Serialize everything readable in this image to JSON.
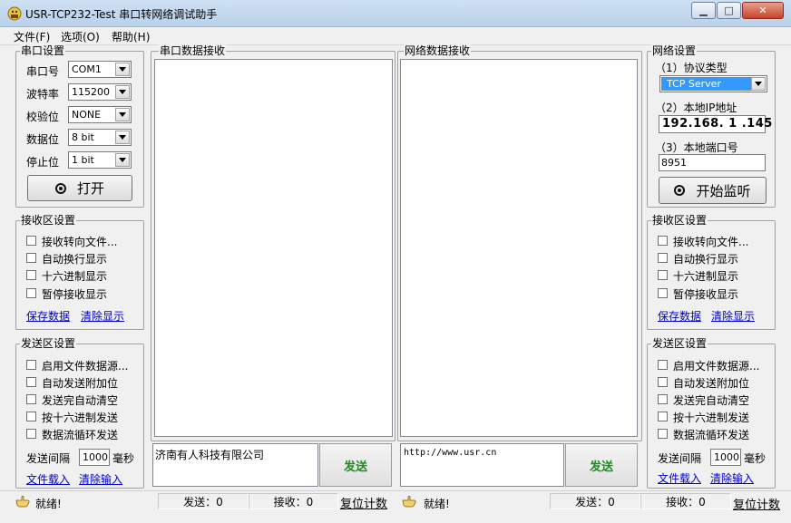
{
  "window": {
    "title": "USR-TCP232-Test 串口转网络调试助手",
    "min_icon": "minimize-icon",
    "max_icon": "maximize-icon",
    "close_icon": "close-icon",
    "min_glyph": "▁",
    "max_glyph": "□",
    "close_glyph": "✕"
  },
  "menu": [
    "文件(F)",
    "选项(O)",
    "帮助(H)"
  ],
  "serial_settings": {
    "title": "串口设置",
    "port_label": "串口号",
    "port_value": "COM1",
    "baud_label": "波特率",
    "baud_value": "115200",
    "parity_label": "校验位",
    "parity_value": "NONE",
    "data_bits_label": "数据位",
    "data_bits_value": "8 bit",
    "stop_bits_label": "停止位",
    "stop_bits_value": "1 bit",
    "open_button": "打开"
  },
  "serial_receive_settings": {
    "title": "接收区设置",
    "options": [
      "接收转向文件...",
      "自动换行显示",
      "十六进制显示",
      "暂停接收显示"
    ],
    "save_link": "保存数据",
    "clear_link": "清除显示"
  },
  "serial_send_settings": {
    "title": "发送区设置",
    "options": [
      "启用文件数据源...",
      "自动发送附加位",
      "发送完自动清空",
      "按十六进制发送",
      "数据流循环发送"
    ],
    "interval_label": "发送间隔",
    "interval_value": "1000",
    "interval_unit": "毫秒",
    "load_link": "文件载入",
    "clear_link": "清除输入"
  },
  "serial_receive_panel": {
    "title": "串口数据接收"
  },
  "network_receive_panel": {
    "title": "网络数据接收"
  },
  "serial_send": {
    "text": "济南有人科技有限公司",
    "button": "发送"
  },
  "network_send": {
    "text": "http://www.usr.cn",
    "button": "发送"
  },
  "network_settings": {
    "title": "网络设置",
    "protocol_label": "（1）协议类型",
    "protocol_value": "TCP Server",
    "ip_label": "（2）本地IP地址",
    "ip_value": "192.168. 1 .145",
    "port_label": "（3）本地端口号",
    "port_value": "8951",
    "listen_button": "开始监听"
  },
  "network_receive_settings": {
    "title": "接收区设置",
    "options": [
      "接收转向文件...",
      "自动换行显示",
      "十六进制显示",
      "暂停接收显示"
    ],
    "save_link": "保存数据",
    "clear_link": "清除显示"
  },
  "network_send_settings": {
    "title": "发送区设置",
    "options": [
      "启用文件数据源...",
      "自动发送附加位",
      "发送完自动清空",
      "按十六进制发送",
      "数据流循环发送"
    ],
    "interval_label": "发送间隔",
    "interval_value": "1000",
    "interval_unit": "毫秒",
    "load_link": "文件载入",
    "clear_link": "清除输入"
  },
  "status_left": {
    "ready": "就绪!",
    "sent": "发送：0",
    "received": "接收：0",
    "reset": "复位计数"
  },
  "status_right": {
    "ready": "就绪!",
    "sent": "发送：0",
    "received": "接收：0",
    "reset": "复位计数"
  },
  "colors": {
    "accent_blue": "#3399ff",
    "send_green": "#1f8a1f",
    "link_blue": "#0000cc"
  }
}
